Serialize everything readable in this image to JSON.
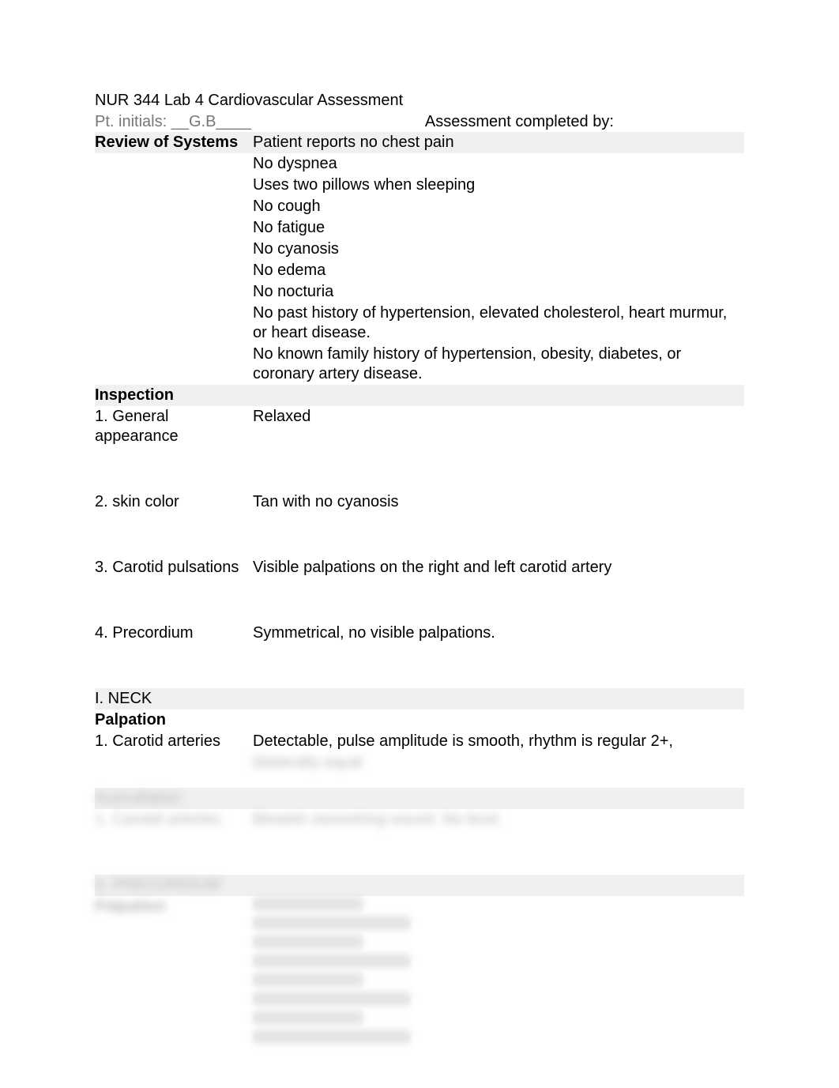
{
  "header": {
    "title": "NUR 344 Lab 4 Cardiovascular Assessment",
    "pt_label": "Pt. initials: __",
    "pt_value": "G.B____",
    "completed_label": "Assessment completed by:"
  },
  "review_of_systems": {
    "label": "Review of Systems",
    "lines": [
      "Patient reports no chest pain",
      "No dyspnea",
      "Uses two pillows when sleeping",
      "No cough",
      "No fatigue",
      "No cyanosis",
      "No edema",
      "No nocturia",
      "No past history of hypertension, elevated cholesterol, heart murmur, or heart disease.",
      "No known family history of hypertension, obesity, diabetes, or coronary artery disease."
    ]
  },
  "inspection": {
    "heading": "Inspection",
    "items": [
      {
        "label": "1. General appearance",
        "value": "Relaxed"
      },
      {
        "label": "2. skin color",
        "value": "Tan with no cyanosis"
      },
      {
        "label": "3. Carotid pulsations",
        "value": "Visible palpations on the right and left carotid artery"
      },
      {
        "label": "4. Precordium",
        "value": "Symmetrical, no visible palpations."
      }
    ]
  },
  "neck": {
    "heading": "I. NECK",
    "palpation_label": "Palpation",
    "carotid_label": "1. Carotid arteries",
    "carotid_value": "Detectable, pulse amplitude is smooth, rhythm is regular 2+,"
  }
}
